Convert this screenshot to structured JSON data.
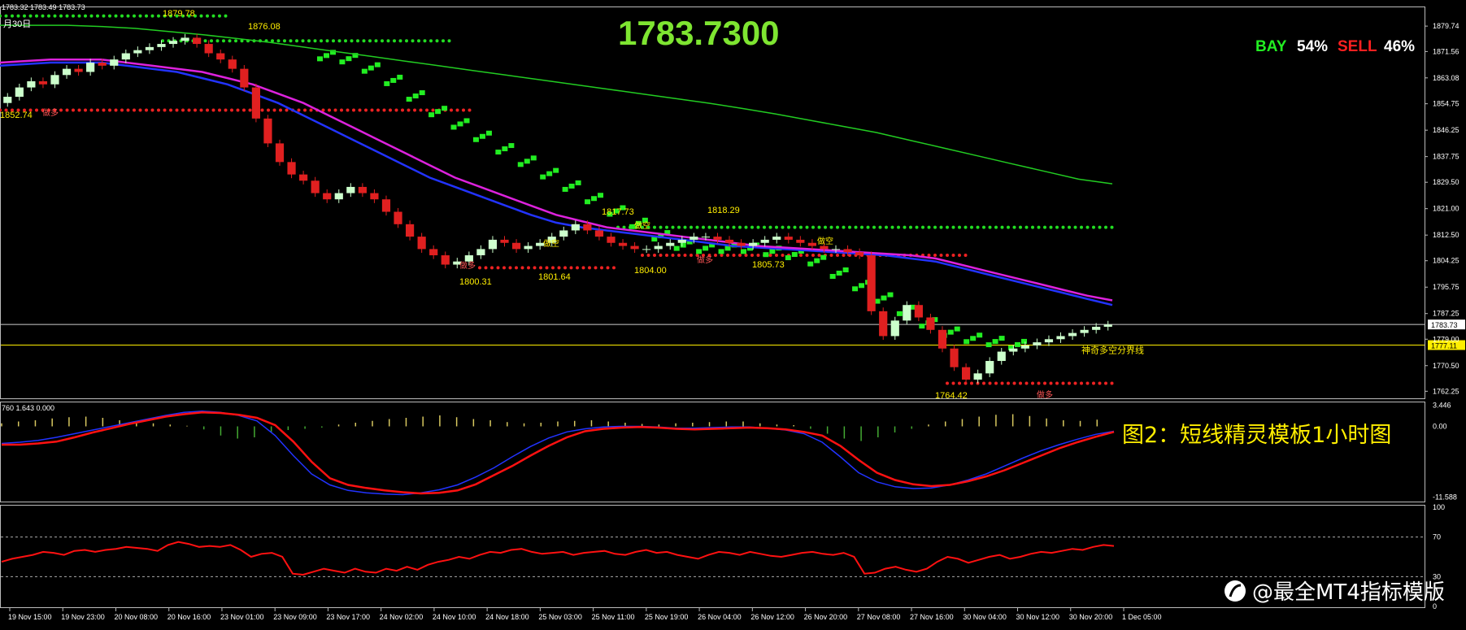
{
  "header": {
    "top_left": "1783.32 1783.49 1783.73",
    "date_label": "月30日",
    "big_price": "1783.7300",
    "bay_label": "BAY",
    "bay_pct": "54%",
    "sell_label": "SELL",
    "sell_pct": "46%"
  },
  "colors": {
    "background": "#000000",
    "bull": "#ccffcc",
    "bear": "#e02020",
    "green_dots": "#22dd22",
    "red_dots": "#ee2222",
    "magenta": "#dd22dd",
    "blue": "#2233ff",
    "lime": "#22cc22",
    "yellow": "#ffee00",
    "axis_text": "#ffffff"
  },
  "chart_data": [
    {
      "type": "candlestick",
      "y_ticks": [
        "1879.74",
        "1871.56",
        "1863.08",
        "1854.75",
        "1846.25",
        "1837.75",
        "1829.50",
        "1821.00",
        "1812.50",
        "1804.25",
        "1795.75",
        "1787.25",
        "1779.00",
        "1770.50",
        "1762.25"
      ],
      "ylim": [
        1760.5,
        1885.0
      ],
      "current_price_label": "1783.73",
      "divider_price_label": "1777.11",
      "divider_label": "神奇多空分界线",
      "price_annotations": [
        "1879.78",
        "1876.08",
        "1852.74",
        "1817.73",
        "1818.29",
        "1800.31",
        "1801.64",
        "1804.00",
        "1805.73",
        "1764.42"
      ],
      "signal_labels": [
        "做多",
        "做空",
        "做多",
        "做空",
        "做多",
        "做空",
        "做多"
      ],
      "green_levels": [
        {
          "value": 1883.0
        },
        {
          "value": 1875.0
        },
        {
          "value": 1815.0
        }
      ],
      "red_levels": [
        {
          "value": 1852.7
        },
        {
          "value": 1802.0
        },
        {
          "value": 1806.0
        },
        {
          "value": 1764.8
        }
      ],
      "close": [
        1857,
        1860,
        1862,
        1861,
        1864,
        1866,
        1865,
        1868,
        1867,
        1869,
        1871,
        1872,
        1873,
        1874,
        1875,
        1876,
        1874,
        1871,
        1869,
        1866,
        1860,
        1850,
        1842,
        1836,
        1832,
        1830,
        1826,
        1824,
        1826,
        1828,
        1826,
        1824,
        1820,
        1816,
        1812,
        1808,
        1806,
        1803,
        1804,
        1806,
        1808,
        1811,
        1810,
        1808,
        1809,
        1810,
        1812,
        1814,
        1816,
        1814,
        1812,
        1810,
        1809,
        1808,
        1808,
        1809,
        1810,
        1811,
        1812,
        1812,
        1811,
        1810,
        1809,
        1810,
        1811,
        1812,
        1811,
        1810,
        1809,
        1808,
        1808,
        1807,
        1806,
        1788,
        1780,
        1785,
        1790,
        1786,
        1782,
        1776,
        1770,
        1766,
        1768,
        1772,
        1775,
        1776,
        1777,
        1778,
        1779,
        1780,
        1781,
        1782,
        1783,
        1783.7
      ],
      "ma_magenta": [
        1868,
        1868.5,
        1869,
        1869,
        1869,
        1868,
        1867,
        1866,
        1865,
        1863,
        1861,
        1858,
        1855,
        1851,
        1847,
        1843,
        1839,
        1835,
        1831,
        1828,
        1825,
        1822,
        1819,
        1817,
        1815,
        1814,
        1813,
        1812,
        1811,
        1810,
        1809,
        1808.5,
        1808,
        1807.5,
        1807,
        1806.5,
        1806,
        1805,
        1803,
        1801,
        1799,
        1797,
        1795,
        1793,
        1791.5
      ],
      "ma_blue": [
        1867,
        1867.5,
        1868,
        1868,
        1868,
        1867,
        1866,
        1865,
        1863,
        1861,
        1858,
        1855,
        1851,
        1847,
        1843,
        1839,
        1835,
        1831,
        1828,
        1825,
        1822,
        1819,
        1816.5,
        1815,
        1814,
        1813,
        1812,
        1811,
        1810,
        1809,
        1808.5,
        1808,
        1807.5,
        1807,
        1806.5,
        1806,
        1805,
        1804,
        1802,
        1800,
        1798,
        1796,
        1794,
        1792,
        1790
      ],
      "ma_long_green": [
        1880,
        1880,
        1880,
        1879.6,
        1879,
        1878,
        1877,
        1875.8,
        1874.5,
        1873,
        1871.5,
        1870,
        1868.5,
        1867,
        1865.5,
        1864,
        1862.5,
        1861,
        1859.5,
        1858,
        1856.5,
        1855,
        1853.3,
        1851.5,
        1849.5,
        1847.5,
        1845.5,
        1843,
        1840.5,
        1838,
        1835.5,
        1833,
        1830.5,
        1829
      ],
      "stair_upper": [
        1870,
        1869,
        1866,
        1862,
        1857,
        1852,
        1848,
        1844,
        1840,
        1836,
        1832,
        1828,
        1824,
        1820,
        1816,
        1812,
        1809,
        1808,
        1808,
        1808,
        1807,
        1806,
        1804,
        1800,
        1796,
        1792,
        1788,
        1784,
        1781,
        1779,
        1778,
        1777
      ]
    },
    {
      "type": "line",
      "header": "760 1.643 0.000",
      "y_ticks": [
        "3.446",
        "0.00",
        "-11.588"
      ],
      "ylim": [
        -12.2,
        3.8
      ],
      "histogram": [
        0.5,
        0.8,
        1.0,
        1.3,
        1.5,
        1.6,
        1.4,
        1.0,
        0.8,
        0.5,
        0.3,
        0.1,
        -0.5,
        -1.5,
        -2.0,
        -1.8,
        -1.0,
        -0.6,
        -0.4,
        -0.2,
        0.3,
        0.6,
        0.9,
        1.2,
        1.4,
        1.6,
        1.8,
        1.5,
        1.2,
        1.0,
        0.7,
        0.5,
        0.6,
        0.8,
        0.9,
        1.0,
        0.8,
        0.6,
        0.4,
        0.3,
        0.5,
        0.6,
        0.7,
        0.8,
        0.8,
        0.5,
        0.3,
        0.2,
        -0.4,
        -1.2,
        -2.0,
        -2.4,
        -1.8,
        -1.0,
        -0.4,
        0.3,
        0.8,
        1.2,
        1.6,
        1.9,
        2.0,
        1.7,
        1.3,
        1.0,
        0.9,
        1.1
      ],
      "red_line": [
        -3,
        -3,
        -2.8,
        -2.5,
        -1.8,
        -1.0,
        -0.3,
        0.4,
        1.0,
        1.6,
        2.0,
        2.3,
        2.2,
        1.9,
        1.4,
        0.2,
        -2.5,
        -5.8,
        -8.5,
        -9.6,
        -10.1,
        -10.5,
        -10.8,
        -11.0,
        -10.9,
        -10.5,
        -9.5,
        -8.0,
        -6.5,
        -4.8,
        -3.2,
        -1.8,
        -0.8,
        -0.4,
        -0.2,
        -0.1,
        -0.2,
        -0.4,
        -0.5,
        -0.4,
        -0.3,
        -0.2,
        -0.3,
        -0.5,
        -0.9,
        -1.5,
        -3.2,
        -5.5,
        -7.6,
        -8.8,
        -9.5,
        -9.8,
        -9.6,
        -9.0,
        -8.2,
        -7.2,
        -6.0,
        -4.8,
        -3.6,
        -2.6,
        -1.7,
        -0.9
      ],
      "blue_line": [
        -2.8,
        -2.6,
        -2.3,
        -1.8,
        -1.2,
        -0.6,
        0.0,
        0.6,
        1.2,
        1.8,
        2.3,
        2.5,
        2.3,
        1.8,
        0.9,
        -1.5,
        -4.8,
        -7.8,
        -9.6,
        -10.5,
        -10.9,
        -11.1,
        -11.2,
        -10.9,
        -10.4,
        -9.6,
        -8.3,
        -6.8,
        -5.0,
        -3.3,
        -1.9,
        -0.9,
        -0.4,
        -0.1,
        0.0,
        0.0,
        -0.1,
        -0.3,
        -0.3,
        -0.2,
        -0.1,
        -0.1,
        -0.3,
        -0.6,
        -1.2,
        -2.6,
        -5.0,
        -7.6,
        -9.1,
        -9.9,
        -10.2,
        -10.1,
        -9.6,
        -8.8,
        -7.8,
        -6.5,
        -5.2,
        -4.0,
        -3.0,
        -2.1,
        -1.3,
        -0.8
      ]
    },
    {
      "type": "line",
      "y_ticks": [
        "100",
        "70",
        "30",
        "0"
      ],
      "ylim": [
        0,
        100
      ],
      "dashed_levels": [
        70,
        30
      ],
      "rsi": [
        45,
        48,
        50,
        52,
        55,
        54,
        52,
        56,
        57,
        55,
        57,
        58,
        60,
        59,
        58,
        56,
        62,
        65,
        63,
        60,
        61,
        60,
        62,
        57,
        50,
        53,
        54,
        50,
        33,
        32,
        35,
        38,
        36,
        34,
        38,
        35,
        34,
        38,
        36,
        40,
        37,
        42,
        45,
        47,
        50,
        48,
        52,
        55,
        54,
        57,
        58,
        55,
        53,
        54,
        55,
        52,
        54,
        55,
        56,
        53,
        52,
        55,
        57,
        54,
        55,
        52,
        50,
        48,
        52,
        55,
        54,
        52,
        55,
        53,
        51,
        50,
        52,
        54,
        55,
        53,
        52,
        54,
        50,
        33,
        34,
        38,
        40,
        37,
        35,
        38,
        45,
        50,
        48,
        44,
        47,
        50,
        52,
        48,
        50,
        53,
        55,
        54,
        56,
        58,
        57,
        60,
        62,
        61
      ]
    }
  ],
  "x_ticks": [
    "19 Nov 15:00",
    "19 Nov 23:00",
    "20 Nov 08:00",
    "20 Nov 16:00",
    "23 Nov 01:00",
    "23 Nov 09:00",
    "23 Nov 17:00",
    "24 Nov 02:00",
    "24 Nov 10:00",
    "24 Nov 18:00",
    "25 Nov 03:00",
    "25 Nov 11:00",
    "25 Nov 19:00",
    "26 Nov 04:00",
    "26 Nov 12:00",
    "26 Nov 20:00",
    "27 Nov 08:00",
    "27 Nov 16:00",
    "30 Nov 04:00",
    "30 Nov 12:00",
    "30 Nov 20:00",
    "1 Dec 05:00"
  ],
  "overlay": {
    "caption": "图2：短线精灵模板1小时图",
    "watermark": "@最全MT4指标模版"
  }
}
